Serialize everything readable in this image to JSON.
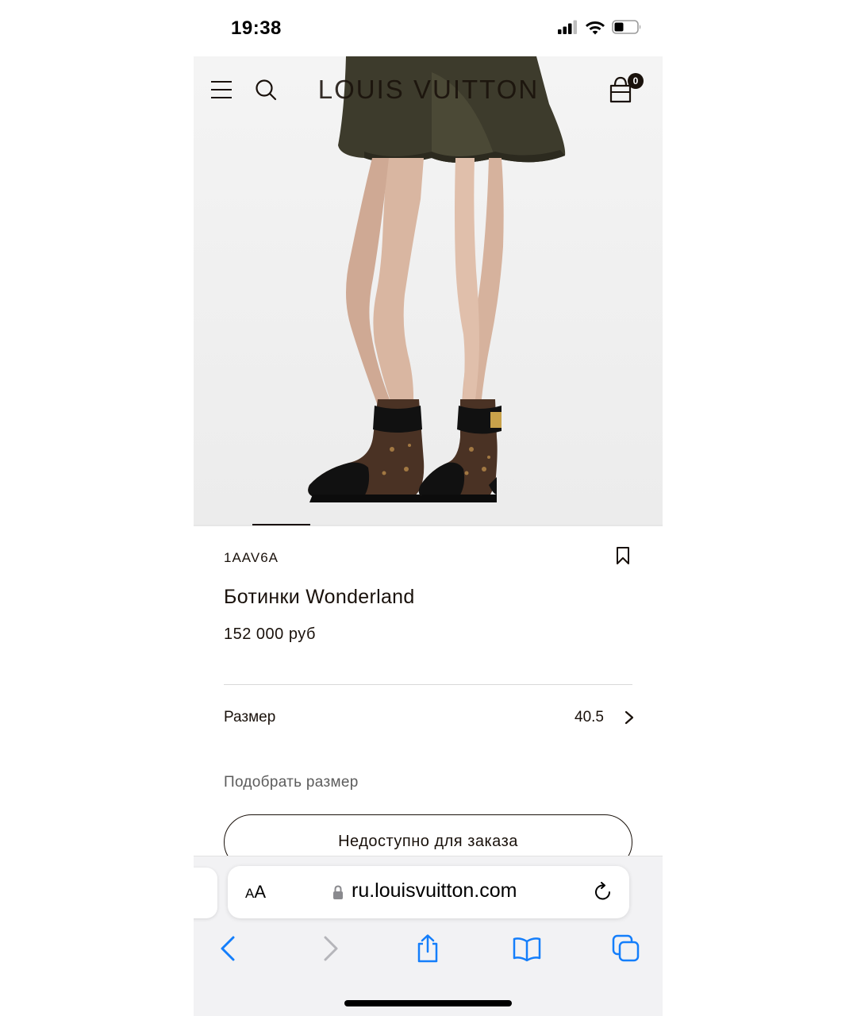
{
  "status_bar": {
    "time": "19:38",
    "icons": [
      "signal-icon",
      "wifi-icon",
      "battery-icon"
    ]
  },
  "header": {
    "brand": "LOUIS VUITTON",
    "cart_count": "0",
    "icons": [
      "menu-icon",
      "search-icon",
      "shopping-bag-icon"
    ]
  },
  "hero": {
    "description_icons": [
      "product-photo"
    ],
    "carousel_position": 1
  },
  "product": {
    "sku": "1AAV6A",
    "name": "Ботинки Wonderland",
    "price": "152 000 руб",
    "size_label": "Размер",
    "size_value": "40.5",
    "size_guide": "Подобрать размер",
    "order_button": "Недоступно для заказа"
  },
  "browser": {
    "aa_small": "A",
    "aa_large": "A",
    "url": "ru.louisvuitton.com",
    "toolbar_icons": [
      "back-icon",
      "forward-icon",
      "share-icon",
      "bookmarks-icon",
      "tabs-icon"
    ]
  },
  "colors": {
    "ink": "#19110b",
    "safari_blue": "#147efb",
    "safari_bg": "#f2f2f4"
  }
}
